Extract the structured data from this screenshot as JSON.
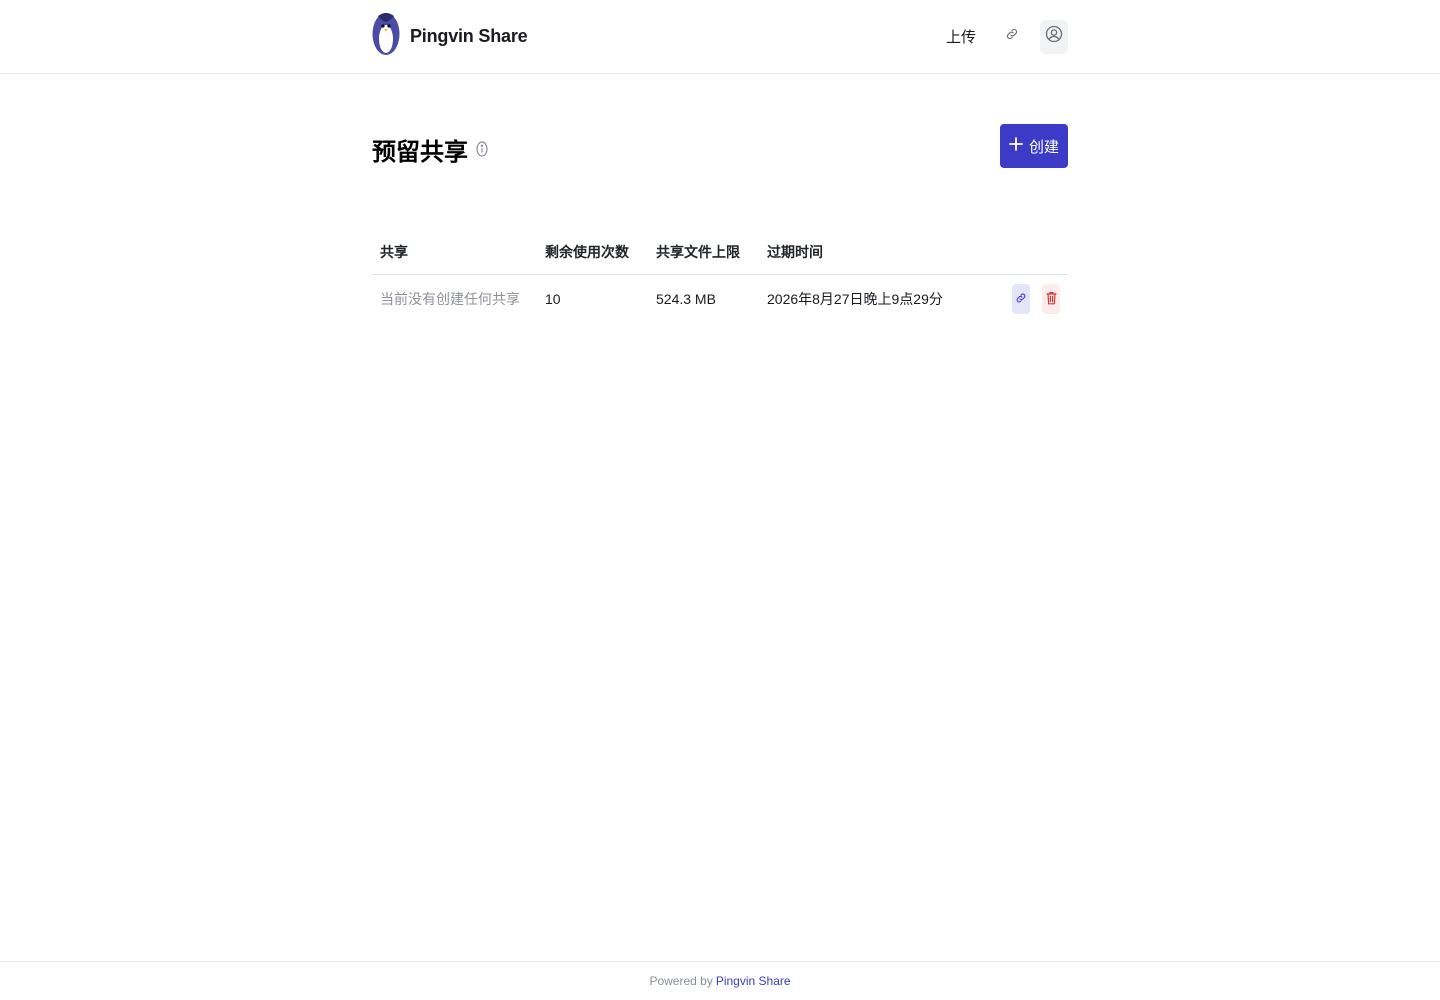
{
  "header": {
    "brand_name": "Pingvin Share",
    "upload_label": "上传"
  },
  "page": {
    "title": "预留共享",
    "create_label": "创建"
  },
  "table": {
    "columns": [
      "共享",
      "剩余使用次数",
      "共享文件上限",
      "过期时间"
    ],
    "rows": [
      {
        "share": "当前没有创建任何共享",
        "remaining_uses": "10",
        "max_size": "524.3 MB",
        "expiration": "2026年8月27日晚上9点29分"
      }
    ]
  },
  "footer": {
    "prefix": "Powered by",
    "link": "Pingvin Share"
  },
  "colors": {
    "accent": "#3b3bc8",
    "danger": "#e03131",
    "muted": "#909296"
  }
}
